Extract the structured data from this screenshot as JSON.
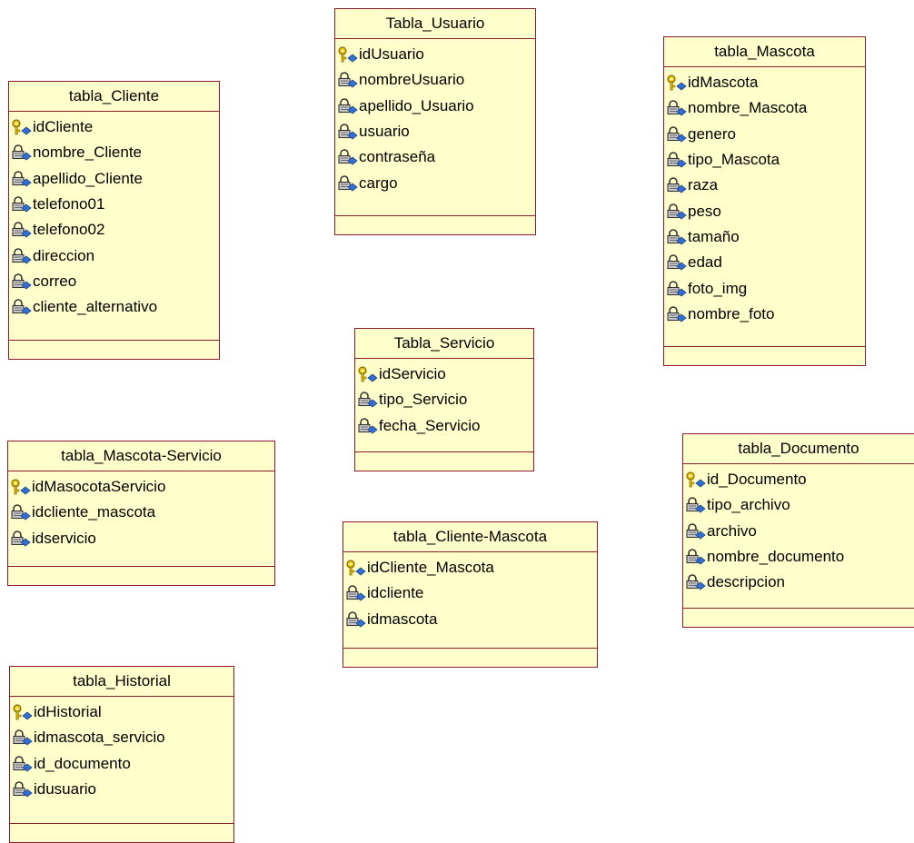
{
  "colors": {
    "entity_fill": "#ffffcc",
    "entity_border": "#8b1a2e",
    "key": "#c8a000",
    "attr_diamond": "#2f6fd6"
  },
  "entities": {
    "tabla_cliente": {
      "title": "tabla_Cliente",
      "attributes": [
        {
          "name": "idCliente",
          "icon": "primary-key-icon"
        },
        {
          "name": "nombre_Cliente",
          "icon": "attribute-icon"
        },
        {
          "name": "apellido_Cliente",
          "icon": "attribute-icon"
        },
        {
          "name": "telefono01",
          "icon": "attribute-icon"
        },
        {
          "name": "telefono02",
          "icon": "attribute-icon"
        },
        {
          "name": "direccion",
          "icon": "attribute-icon"
        },
        {
          "name": "correo",
          "icon": "attribute-icon"
        },
        {
          "name": "cliente_alternativo",
          "icon": "attribute-icon"
        }
      ]
    },
    "tabla_usuario": {
      "title": "Tabla_Usuario",
      "attributes": [
        {
          "name": "idUsuario",
          "icon": "primary-key-icon"
        },
        {
          "name": "nombreUsuario",
          "icon": "attribute-icon"
        },
        {
          "name": "apellido_Usuario",
          "icon": "attribute-icon"
        },
        {
          "name": "usuario",
          "icon": "attribute-icon"
        },
        {
          "name": "contraseña",
          "icon": "attribute-icon"
        },
        {
          "name": "cargo",
          "icon": "attribute-icon"
        }
      ]
    },
    "tabla_mascota": {
      "title": "tabla_Mascota",
      "attributes": [
        {
          "name": "idMascota",
          "icon": "primary-key-icon"
        },
        {
          "name": "nombre_Mascota",
          "icon": "attribute-icon"
        },
        {
          "name": "genero",
          "icon": "attribute-icon"
        },
        {
          "name": "tipo_Mascota",
          "icon": "attribute-icon"
        },
        {
          "name": "raza",
          "icon": "attribute-icon"
        },
        {
          "name": "peso",
          "icon": "attribute-icon"
        },
        {
          "name": "tamaño",
          "icon": "attribute-icon"
        },
        {
          "name": "edad",
          "icon": "attribute-icon"
        },
        {
          "name": "foto_img",
          "icon": "attribute-icon"
        },
        {
          "name": "nombre_foto",
          "icon": "attribute-icon"
        }
      ]
    },
    "tabla_servicio": {
      "title": "Tabla_Servicio",
      "attributes": [
        {
          "name": "idServicio",
          "icon": "primary-key-icon"
        },
        {
          "name": "tipo_Servicio",
          "icon": "attribute-icon"
        },
        {
          "name": "fecha_Servicio",
          "icon": "attribute-icon"
        }
      ]
    },
    "tabla_mascota_servicio": {
      "title": "tabla_Mascota-Servicio",
      "attributes": [
        {
          "name": "idMasocotaServicio",
          "icon": "primary-key-icon"
        },
        {
          "name": "idcliente_mascota",
          "icon": "attribute-icon"
        },
        {
          "name": "idservicio",
          "icon": "attribute-icon"
        }
      ]
    },
    "tabla_documento": {
      "title": "tabla_Documento",
      "attributes": [
        {
          "name": "id_Documento",
          "icon": "primary-key-icon"
        },
        {
          "name": "tipo_archivo",
          "icon": "attribute-icon"
        },
        {
          "name": "archivo",
          "icon": "attribute-icon"
        },
        {
          "name": "nombre_documento",
          "icon": "attribute-icon"
        },
        {
          "name": "descripcion",
          "icon": "attribute-icon"
        }
      ]
    },
    "tabla_cliente_mascota": {
      "title": "tabla_Cliente-Mascota",
      "attributes": [
        {
          "name": "idCliente_Mascota",
          "icon": "primary-key-icon"
        },
        {
          "name": "idcliente",
          "icon": "attribute-icon"
        },
        {
          "name": "idmascota",
          "icon": "attribute-icon"
        }
      ]
    },
    "tabla_historial": {
      "title": "tabla_Historial",
      "attributes": [
        {
          "name": "idHistorial",
          "icon": "primary-key-icon"
        },
        {
          "name": "idmascota_servicio",
          "icon": "attribute-icon"
        },
        {
          "name": "id_documento",
          "icon": "attribute-icon"
        },
        {
          "name": "idusuario",
          "icon": "attribute-icon"
        }
      ]
    }
  }
}
